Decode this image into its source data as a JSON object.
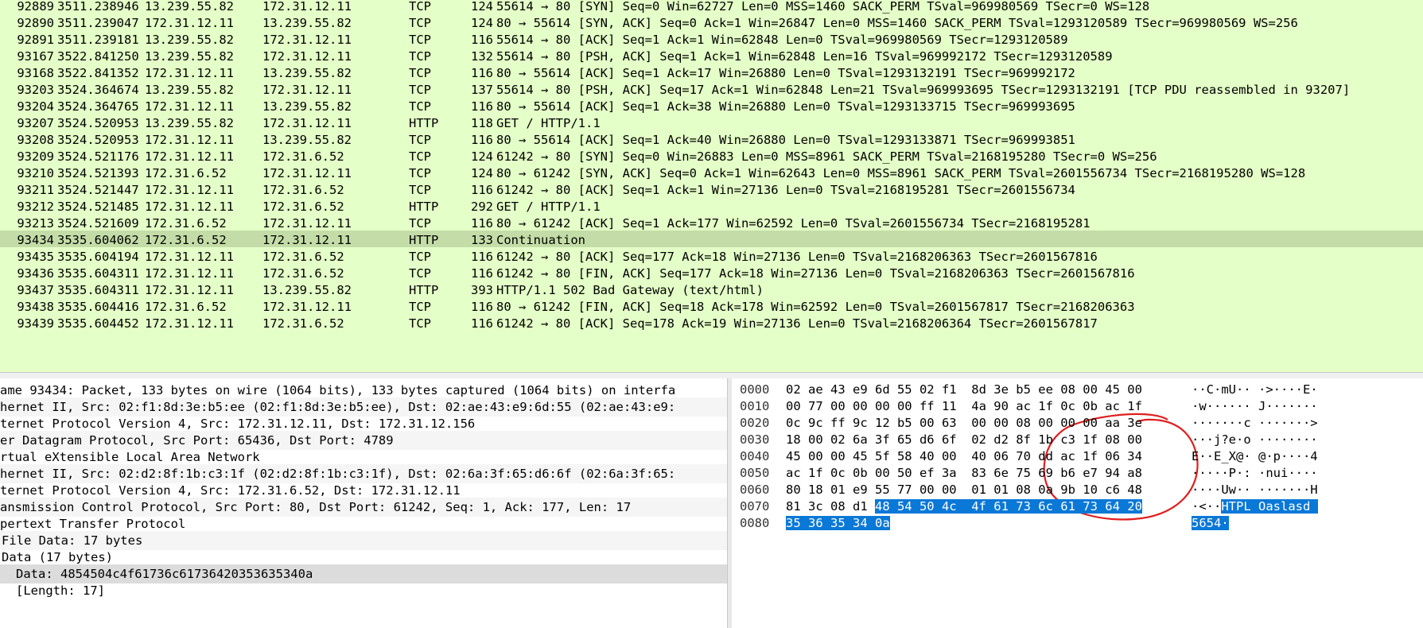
{
  "packet_list": {
    "rows": [
      {
        "no": "92889",
        "time": "3511.238946",
        "src": "13.239.55.82",
        "dst": "172.31.12.11",
        "proto": "TCP",
        "len": "124",
        "info": "55614 → 80 [SYN] Seq=0 Win=62727 Len=0 MSS=1460 SACK_PERM TSval=969980569 TSecr=0 WS=128",
        "selected": false
      },
      {
        "no": "92890",
        "time": "3511.239047",
        "src": "172.31.12.11",
        "dst": "13.239.55.82",
        "proto": "TCP",
        "len": "124",
        "info": "80 → 55614 [SYN, ACK] Seq=0 Ack=1 Win=26847 Len=0 MSS=1460 SACK_PERM TSval=1293120589 TSecr=969980569 WS=256",
        "selected": false
      },
      {
        "no": "92891",
        "time": "3511.239181",
        "src": "13.239.55.82",
        "dst": "172.31.12.11",
        "proto": "TCP",
        "len": "116",
        "info": "55614 → 80 [ACK] Seq=1 Ack=1 Win=62848 Len=0 TSval=969980569 TSecr=1293120589",
        "selected": false
      },
      {
        "no": "93167",
        "time": "3522.841250",
        "src": "13.239.55.82",
        "dst": "172.31.12.11",
        "proto": "TCP",
        "len": "132",
        "info": "55614 → 80 [PSH, ACK] Seq=1 Ack=1 Win=62848 Len=16 TSval=969992172 TSecr=1293120589",
        "selected": false
      },
      {
        "no": "93168",
        "time": "3522.841352",
        "src": "172.31.12.11",
        "dst": "13.239.55.82",
        "proto": "TCP",
        "len": "116",
        "info": "80 → 55614 [ACK] Seq=1 Ack=17 Win=26880 Len=0 TSval=1293132191 TSecr=969992172",
        "selected": false
      },
      {
        "no": "93203",
        "time": "3524.364674",
        "src": "13.239.55.82",
        "dst": "172.31.12.11",
        "proto": "TCP",
        "len": "137",
        "info": "55614 → 80 [PSH, ACK] Seq=17 Ack=1 Win=62848 Len=21 TSval=969993695 TSecr=1293132191 [TCP PDU reassembled in 93207]",
        "selected": false
      },
      {
        "no": "93204",
        "time": "3524.364765",
        "src": "172.31.12.11",
        "dst": "13.239.55.82",
        "proto": "TCP",
        "len": "116",
        "info": "80 → 55614 [ACK] Seq=1 Ack=38 Win=26880 Len=0 TSval=1293133715 TSecr=969993695",
        "selected": false
      },
      {
        "no": "93207",
        "time": "3524.520953",
        "src": "13.239.55.82",
        "dst": "172.31.12.11",
        "proto": "HTTP",
        "len": "118",
        "info": "GET / HTTP/1.1",
        "selected": false
      },
      {
        "no": "93208",
        "time": "3524.520953",
        "src": "172.31.12.11",
        "dst": "13.239.55.82",
        "proto": "TCP",
        "len": "116",
        "info": "80 → 55614 [ACK] Seq=1 Ack=40 Win=26880 Len=0 TSval=1293133871 TSecr=969993851",
        "selected": false
      },
      {
        "no": "93209",
        "time": "3524.521176",
        "src": "172.31.12.11",
        "dst": "172.31.6.52",
        "proto": "TCP",
        "len": "124",
        "info": "61242 → 80 [SYN] Seq=0 Win=26883 Len=0 MSS=8961 SACK_PERM TSval=2168195280 TSecr=0 WS=256",
        "selected": false
      },
      {
        "no": "93210",
        "time": "3524.521393",
        "src": "172.31.6.52",
        "dst": "172.31.12.11",
        "proto": "TCP",
        "len": "124",
        "info": "80 → 61242 [SYN, ACK] Seq=0 Ack=1 Win=62643 Len=0 MSS=8961 SACK_PERM TSval=2601556734 TSecr=2168195280 WS=128",
        "selected": false
      },
      {
        "no": "93211",
        "time": "3524.521447",
        "src": "172.31.12.11",
        "dst": "172.31.6.52",
        "proto": "TCP",
        "len": "116",
        "info": "61242 → 80 [ACK] Seq=1 Ack=1 Win=27136 Len=0 TSval=2168195281 TSecr=2601556734",
        "selected": false
      },
      {
        "no": "93212",
        "time": "3524.521485",
        "src": "172.31.12.11",
        "dst": "172.31.6.52",
        "proto": "HTTP",
        "len": "292",
        "info": "GET / HTTP/1.1",
        "selected": false
      },
      {
        "no": "93213",
        "time": "3524.521609",
        "src": "172.31.6.52",
        "dst": "172.31.12.11",
        "proto": "TCP",
        "len": "116",
        "info": "80 → 61242 [ACK] Seq=1 Ack=177 Win=62592 Len=0 TSval=2601556734 TSecr=2168195281",
        "selected": false
      },
      {
        "no": "93434",
        "time": "3535.604062",
        "src": "172.31.6.52",
        "dst": "172.31.12.11",
        "proto": "HTTP",
        "len": "133",
        "info": "Continuation",
        "selected": true
      },
      {
        "no": "93435",
        "time": "3535.604194",
        "src": "172.31.12.11",
        "dst": "172.31.6.52",
        "proto": "TCP",
        "len": "116",
        "info": "61242 → 80 [ACK] Seq=177 Ack=18 Win=27136 Len=0 TSval=2168206363 TSecr=2601567816",
        "selected": false
      },
      {
        "no": "93436",
        "time": "3535.604311",
        "src": "172.31.12.11",
        "dst": "172.31.6.52",
        "proto": "TCP",
        "len": "116",
        "info": "61242 → 80 [FIN, ACK] Seq=177 Ack=18 Win=27136 Len=0 TSval=2168206363 TSecr=2601567816",
        "selected": false
      },
      {
        "no": "93437",
        "time": "3535.604311",
        "src": "172.31.12.11",
        "dst": "13.239.55.82",
        "proto": "HTTP",
        "len": "393",
        "info": "HTTP/1.1 502 Bad Gateway  (text/html)",
        "selected": false
      },
      {
        "no": "93438",
        "time": "3535.604416",
        "src": "172.31.6.52",
        "dst": "172.31.12.11",
        "proto": "TCP",
        "len": "116",
        "info": "80 → 61242 [FIN, ACK] Seq=18 Ack=178 Win=62592 Len=0 TSval=2601567817 TSecr=2168206363",
        "selected": false
      },
      {
        "no": "93439",
        "time": "3535.604452",
        "src": "172.31.12.11",
        "dst": "172.31.6.52",
        "proto": "TCP",
        "len": "116",
        "info": "61242 → 80 [ACK] Seq=178 Ack=19 Win=27136 Len=0 TSval=2168206364 TSecr=2601567817",
        "selected": false
      }
    ]
  },
  "details": {
    "rows": [
      {
        "text": "ame 93434: Packet, 133 bytes on wire (1064 bits), 133 bytes captured (1064 bits) on interfa",
        "indent": 0,
        "style": "normal"
      },
      {
        "text": "hernet II, Src: 02:f1:8d:3e:b5:ee (02:f1:8d:3e:b5:ee), Dst: 02:ae:43:e9:6d:55 (02:ae:43:e9:",
        "indent": 0,
        "style": "alt"
      },
      {
        "text": "ternet Protocol Version 4, Src: 172.31.12.11, Dst: 172.31.12.156",
        "indent": 0,
        "style": "normal"
      },
      {
        "text": "er Datagram Protocol, Src Port: 65436, Dst Port: 4789",
        "indent": 0,
        "style": "alt"
      },
      {
        "text": "rtual eXtensible Local Area Network",
        "indent": 0,
        "style": "normal"
      },
      {
        "text": "hernet II, Src: 02:d2:8f:1b:c3:1f (02:d2:8f:1b:c3:1f), Dst: 02:6a:3f:65:d6:6f (02:6a:3f:65:",
        "indent": 0,
        "style": "alt"
      },
      {
        "text": "ternet Protocol Version 4, Src: 172.31.6.52, Dst: 172.31.12.11",
        "indent": 0,
        "style": "normal"
      },
      {
        "text": "ansmission Control Protocol, Src Port: 80, Dst Port: 61242, Seq: 1, Ack: 177, Len: 17",
        "indent": 0,
        "style": "alt"
      },
      {
        "text": "pertext Transfer Protocol",
        "indent": 0,
        "style": "normal"
      },
      {
        "text": "File Data: 17 bytes",
        "indent": 1,
        "style": "alt"
      },
      {
        "text": "Data (17 bytes)",
        "indent": 1,
        "style": "normal"
      },
      {
        "text": "Data: 4854504c4f61736c61736420353635340a",
        "indent": 2,
        "style": "hl"
      },
      {
        "text": "[Length: 17]",
        "indent": 2,
        "style": "normal"
      }
    ]
  },
  "bytes": {
    "rows": [
      {
        "offset": "0000",
        "hex_plain": "02 ae 43 e9 6d 55 02 f1  8d 3e b5 ee 08 00 45 00",
        "hex_sel": "",
        "ascii_plain": "··C·mU·· ·>····E·",
        "ascii_sel": ""
      },
      {
        "offset": "0010",
        "hex_plain": "00 77 00 00 00 00 ff 11  4a 90 ac 1f 0c 0b ac 1f",
        "hex_sel": "",
        "ascii_plain": "·w······ J·······",
        "ascii_sel": ""
      },
      {
        "offset": "0020",
        "hex_plain": "0c 9c ff 9c 12 b5 00 63  00 00 08 00 00 00 aa 3e",
        "hex_sel": "",
        "ascii_plain": "·······c ·······>",
        "ascii_sel": ""
      },
      {
        "offset": "0030",
        "hex_plain": "18 00 02 6a 3f 65 d6 6f  02 d2 8f 1b c3 1f 08 00",
        "hex_sel": "",
        "ascii_plain": "···j?e·o ········",
        "ascii_sel": ""
      },
      {
        "offset": "0040",
        "hex_plain": "45 00 00 45 5f 58 40 00  40 06 70 dd ac 1f 06 34",
        "hex_sel": "",
        "ascii_plain": "E··E_X@· @·p····4",
        "ascii_sel": ""
      },
      {
        "offset": "0050",
        "hex_plain": "ac 1f 0c 0b 00 50 ef 3a  83 6e 75 69 b6 e7 94 a8",
        "hex_sel": "",
        "ascii_plain": "·····P·: ·nui····",
        "ascii_sel": ""
      },
      {
        "offset": "0060",
        "hex_plain": "80 18 01 e9 55 77 00 00  01 01 08 0a 9b 10 c6 48",
        "hex_sel": "",
        "ascii_plain": "····Uw·· ·······H",
        "ascii_sel": ""
      },
      {
        "offset": "0070",
        "hex_plain": "81 3c 08 d1 ",
        "hex_sel": "48 54 50 4c  4f 61 73 6c 61 73 64 20",
        "ascii_plain": "·<··",
        "ascii_sel": "HTPL Oaslasd "
      },
      {
        "offset": "0080",
        "hex_plain": "",
        "hex_sel": "35 36 35 34 0a",
        "ascii_plain": "",
        "ascii_sel": "5654·"
      }
    ]
  },
  "colors": {
    "tcp_row_bg": "#e4ffc7",
    "selected_row_bg": "#c4dda8",
    "byte_selection": "#0a78d7",
    "annotation_circle": "#e01e1e"
  }
}
